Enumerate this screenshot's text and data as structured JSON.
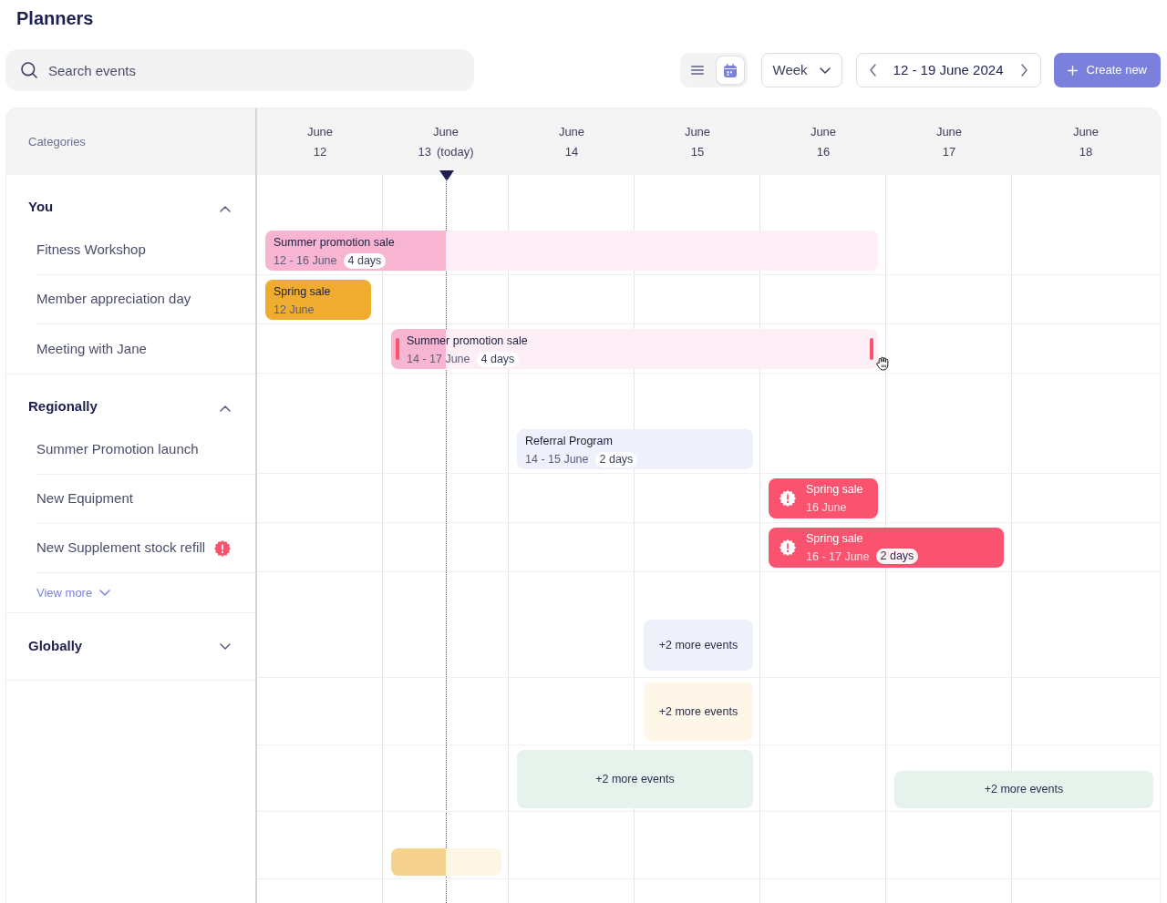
{
  "page": {
    "title": "Planners"
  },
  "toolbar": {
    "search": {
      "placeholder": "Search events"
    },
    "views": [
      {
        "kind": "list",
        "selected": false
      },
      {
        "kind": "calendar",
        "selected": true
      }
    ],
    "range_select": {
      "value": "Week"
    },
    "date_range": {
      "label": "12 - 19 June 2024"
    },
    "create_button": {
      "label": "Create new"
    }
  },
  "calendar": {
    "categories_label": "Categories",
    "days": [
      {
        "month": "June",
        "day": "12",
        "today": false
      },
      {
        "month": "June",
        "day": "13",
        "note": "(today)",
        "today": true
      },
      {
        "month": "June",
        "day": "14",
        "today": false
      },
      {
        "month": "June",
        "day": "15",
        "today": false
      },
      {
        "month": "June",
        "day": "16",
        "today": false
      },
      {
        "month": "June",
        "day": "17",
        "today": false
      },
      {
        "month": "June",
        "day": "18",
        "today": false
      }
    ],
    "groups": [
      {
        "title": "You",
        "expanded": true,
        "items": [
          {
            "label": "Fitness Workshop",
            "alert": false
          },
          {
            "label": "Member appreciation day",
            "alert": false
          },
          {
            "label": "Meeting with Jane",
            "alert": false
          }
        ]
      },
      {
        "title": "Regionally",
        "expanded": true,
        "items": [
          {
            "label": "Summer Promotion launch",
            "alert": false
          },
          {
            "label": "New Equipment",
            "alert": false
          },
          {
            "label": "New Supplement stock refill",
            "alert": true
          }
        ],
        "more_link": "View more"
      },
      {
        "title": "Globally",
        "expanded": false
      }
    ],
    "events": [
      {
        "kind": "event",
        "title": "Summer promotion sale",
        "dates": "12 - 16 June",
        "duration": "4 days",
        "color": "#f7b5d2",
        "level": 0.295,
        "selected": false
      },
      {
        "kind": "event",
        "title": "Spring sale",
        "dates": "12 June",
        "color": "#efac2e",
        "selected": false
      },
      {
        "kind": "event",
        "title": "Summer promotion sale",
        "dates": "14 - 17 June",
        "duration": "4 days",
        "color": "#f7b5d2",
        "level": 0.112,
        "selected": true
      },
      {
        "kind": "event",
        "title": "Referral Program",
        "dates": "14 - 15 June",
        "duration": "2 days",
        "color": "#eef0fb",
        "selected": false
      },
      {
        "kind": "alert",
        "title": "Spring sale",
        "dates": "16 June",
        "color": "#f9536f",
        "selected": false
      },
      {
        "kind": "alert",
        "title": "Spring sale",
        "dates": "16 - 17 June",
        "duration": "2 days",
        "color": "#f9536f",
        "selected": false
      },
      {
        "kind": "more",
        "label": "+2 more events",
        "color": "#eff1fa",
        "selected": false
      },
      {
        "kind": "more",
        "label": "+2 more events",
        "color": "#fdf6e9",
        "selected": false
      },
      {
        "kind": "more",
        "label": "+2 more events",
        "color": "#e6f3ec",
        "selected": false
      },
      {
        "kind": "more",
        "label": "+2 more events",
        "color": "#e6f3ec",
        "selected": false
      },
      {
        "kind": "event",
        "color": "#f5d38f",
        "level": 0.496,
        "selected": false
      }
    ]
  }
}
